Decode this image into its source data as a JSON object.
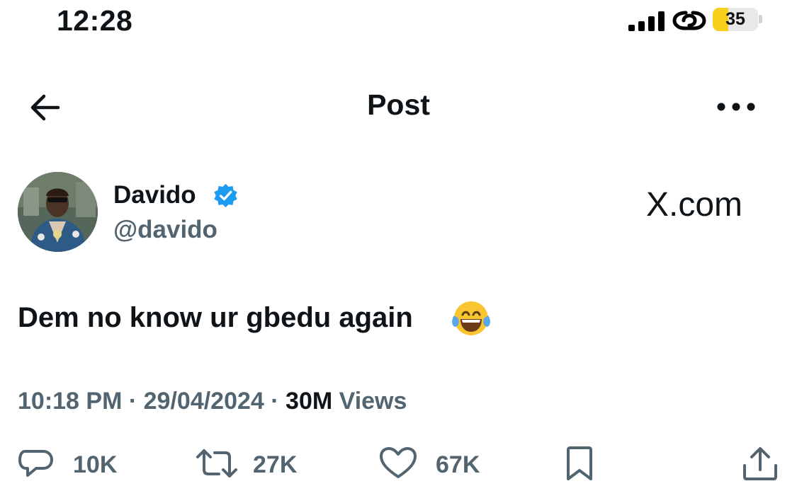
{
  "status_bar": {
    "time": "12:28",
    "signal_icon": "cellular-signal-icon",
    "connection_icon": "link-icon",
    "battery_level": "35",
    "battery_fraction": 0.35,
    "battery_color": "#f7d01c"
  },
  "nav": {
    "back_icon": "arrow-left-icon",
    "title": "Post",
    "more_icon": "ellipsis-icon"
  },
  "author": {
    "name": "Davido",
    "handle": "@davido",
    "verified_color": "#1d9bf0"
  },
  "watermark": "X.com",
  "post": {
    "text": "Dem no know ur gbedu again",
    "emoji": "face-with-tears-of-joy-icon"
  },
  "meta": {
    "time": "10:18 PM",
    "separator": "·",
    "date": "29/04/2024",
    "views_count": "30M",
    "views_label": "Views"
  },
  "actions": {
    "replies": "10K",
    "reposts": "27K",
    "likes": "67K"
  },
  "colors": {
    "text_primary": "#0f1419",
    "text_secondary": "#536471"
  }
}
